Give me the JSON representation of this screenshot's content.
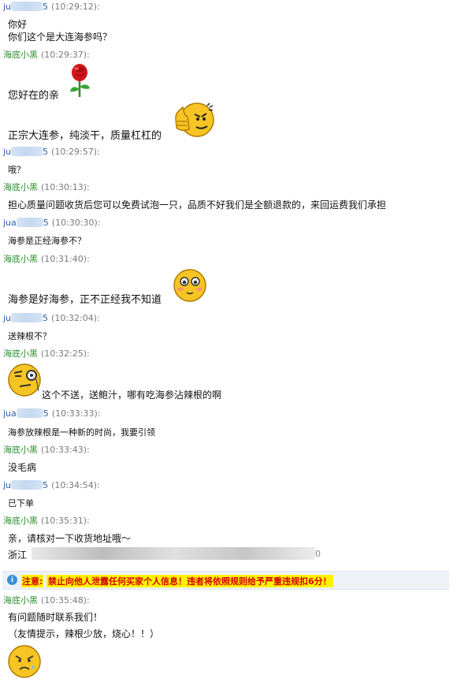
{
  "labels": {
    "agent": "海底小黑",
    "customer_prefix": "ju",
    "customer_prefix_short": "jua",
    "customer_suffix": "5"
  },
  "messages": [
    {
      "time": "(10:29:12):",
      "lines": [
        "你好",
        "你们这个是大连海参吗？"
      ]
    },
    {
      "time": "(10:29:37):",
      "lines": [
        "您好在的亲",
        "正宗大连参，纯淡干，质量杠杠的"
      ]
    },
    {
      "time": "(10:29:57):",
      "lines": [
        "哦？"
      ]
    },
    {
      "time": "(10:30:13):",
      "lines": [
        "担心质量问题收货后您可以免费试泡一只，品质不好我们是全额退款的，来回运费我们承担"
      ]
    },
    {
      "time": "(10:30:30):",
      "lines": [
        "海参是正经海参不？"
      ]
    },
    {
      "time": "(10:31:40):",
      "lines": [
        "海参是好海参，正不正经我不知道"
      ]
    },
    {
      "time": "(10:32:04):",
      "lines": [
        "送辣根不？"
      ]
    },
    {
      "time": "(10:32:25):",
      "lines": [
        "这个不送，送鲍汁，哪有吃海参沾辣根的啊"
      ]
    },
    {
      "time": "(10:33:33):",
      "lines": [
        "海参放辣根是一种新的时尚，我要引领"
      ]
    },
    {
      "time": "(10:33:43):",
      "lines": [
        "没毛病"
      ]
    },
    {
      "time": "(10:34:54):",
      "lines": [
        "已下单"
      ]
    },
    {
      "time": "(10:35:31):",
      "lines": [
        "亲，请核对一下收货地址哦～",
        "浙江"
      ]
    },
    {
      "time": "(10:35:48):",
      "lines": [
        "有问题随时联系我们！",
        "（友情提示，辣根少放，烧心！！）"
      ]
    }
  ],
  "address_tail_fragment": "0",
  "notice": {
    "label": "注意:",
    "text": "禁止向他人泄露任何买家个人信息！违者将依照规则给予严重违规扣6分！",
    "color": "#d40000",
    "highlight": "#fff200"
  },
  "emoticons": [
    "rose-icon",
    "thumbs-up-icon",
    "blushing-face-icon",
    "monocle-face-icon",
    "worried-face-icon"
  ],
  "colors": {
    "agent_name": "#2f8f2f",
    "customer_name": "#2d5da8",
    "timestamp": "#7a7a7a"
  }
}
